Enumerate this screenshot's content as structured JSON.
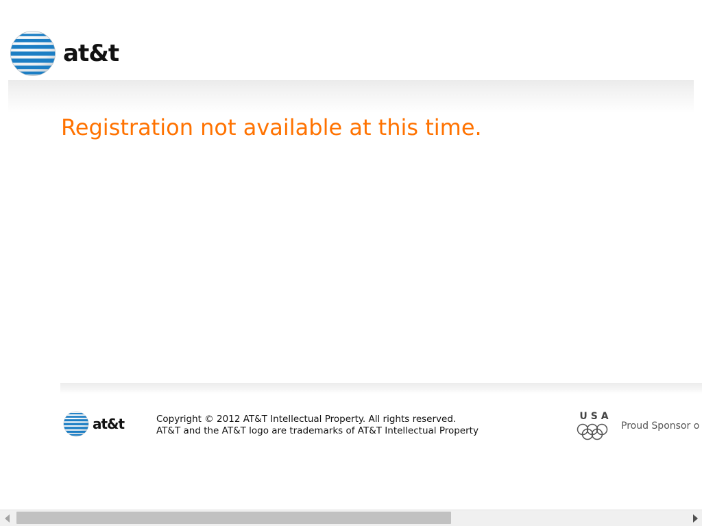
{
  "header": {
    "logo_icon": "att-globe-icon",
    "brand_wordmark": "at&t"
  },
  "main": {
    "message": "Registration not available at this time."
  },
  "footer": {
    "logo_icon": "att-globe-icon",
    "brand_wordmark": "at&t",
    "copyright_line": "Copyright © 2012 AT&T Intellectual Property. All rights reserved.",
    "trademark_line": "AT&T and the AT&T logo are trademarks of AT&T Intellectual Property",
    "sponsor_icon": "usa-olympic-rings-icon",
    "sponsor_mark_text": "USA",
    "sponsor_text": "Proud Sponsor o"
  },
  "scrollbar": {
    "left_icon": "scroll-left-arrow-icon",
    "right_icon": "scroll-right-arrow-icon"
  },
  "colors": {
    "message": "#ff7200",
    "globe_blue": "#1c7ec4",
    "text": "#111111",
    "sponsor_text": "#555555",
    "scroll_thumb": "#c1c1c1"
  }
}
